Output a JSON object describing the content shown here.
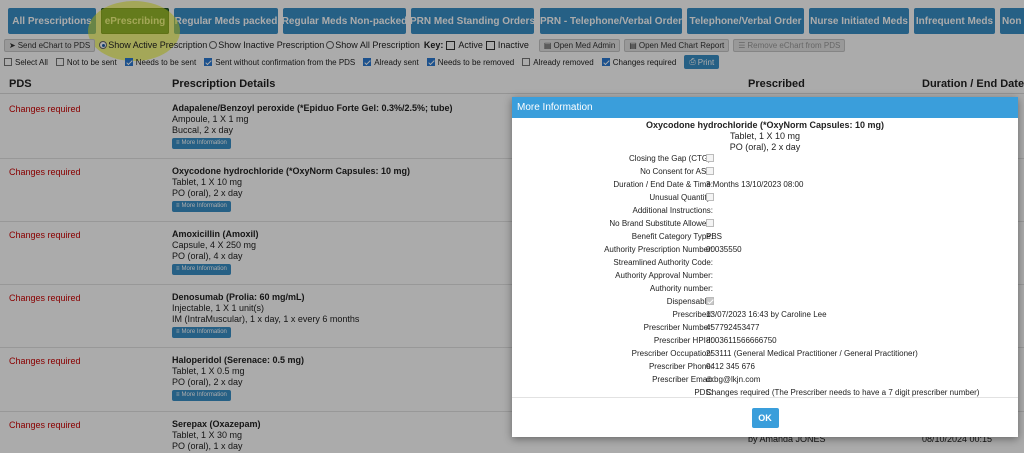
{
  "tabs": [
    {
      "label": "All Prescriptions"
    },
    {
      "label": "ePrescribing"
    },
    {
      "label": "Regular Meds packed"
    },
    {
      "label": "Regular Meds Non-packed"
    },
    {
      "label": "PRN Med Standing Orders"
    },
    {
      "label": "PRN - Telephone/Verbal Order"
    },
    {
      "label": "Telephone/Verbal Order"
    },
    {
      "label": "Nurse Initiated Meds"
    },
    {
      "label": "Infrequent Meds"
    },
    {
      "label": "Non"
    }
  ],
  "toolbar": {
    "send_label": "Send eChart to PDS",
    "radio_active": "Show Active Prescription",
    "radio_inactive": "Show Inactive Prescription",
    "radio_all": "Show All Prescription",
    "key_label": "Key:",
    "key_active": "Active",
    "key_inactive": "Inactive",
    "open_admin": "Open Med Admin",
    "open_report": "Open Med Chart Report",
    "remove_label": "Remove eChart from PDS"
  },
  "filters": [
    {
      "label": "Select All",
      "checked": false
    },
    {
      "label": "Not to be sent",
      "checked": false
    },
    {
      "label": "Needs to be sent",
      "checked": true
    },
    {
      "label": "Sent without confirmation from the PDS",
      "checked": true
    },
    {
      "label": "Already sent",
      "checked": true
    },
    {
      "label": "Needs to be removed",
      "checked": true
    },
    {
      "label": "Already removed",
      "checked": false
    },
    {
      "label": "Changes required",
      "checked": true
    }
  ],
  "print_label": "Print",
  "columns": {
    "pds": "PDS",
    "details": "Prescription Details",
    "prescribed": "Prescribed",
    "end": "Duration / End Date &"
  },
  "rows": [
    {
      "status": "Changes required",
      "name": "Adapalene/Benzoyl peroxide (*Epiduo Forte Gel: 0.3%/2.5%; tube)",
      "line1": "Ampoule, 1 X 1 mg",
      "line2": "Buccal, 2 x day",
      "more": "More Information",
      "prescribed": "",
      "end": ""
    },
    {
      "status": "Changes required",
      "name": "Oxycodone hydrochloride (*OxyNorm Capsules: 10 mg)",
      "line1": "Tablet, 1 X 10 mg",
      "line2": "PO (oral), 2 x day",
      "more": "More Information",
      "prescribed": "",
      "end": ""
    },
    {
      "status": "Changes required",
      "name": "Amoxicillin (Amoxil)",
      "line1": "Capsule, 4 X 250 mg",
      "line2": "PO (oral), 4 x day",
      "more": "More Information",
      "prescribed": "",
      "end": ""
    },
    {
      "status": "Changes required",
      "name": "Denosumab (Prolia: 60 mg/mL)",
      "line1": "Injectable, 1 X 1 unit(s)",
      "line2": "IM (IntraMuscular), 1 x day, 1 x every 6 months",
      "more": "More Information",
      "prescribed": "",
      "end": ""
    },
    {
      "status": "Changes required",
      "name": "Haloperidol (Serenace: 0.5 mg)",
      "line1": "Tablet, 1 X 0.5 mg",
      "line2": "PO (oral), 2 x day",
      "more": "More Information",
      "prescribed": "",
      "end": ""
    },
    {
      "status": "Changes required",
      "name": "Serepax (Oxazepam)",
      "line1": "Tablet, 1 X 30 mg",
      "line2": "PO (oral), 1 x day",
      "more": "",
      "prescribed": "by Amanda JONES",
      "end": "08/10/2024 00:15"
    }
  ],
  "modal": {
    "title": "More Information",
    "drug_name": "Oxycodone hydrochloride (*OxyNorm Capsules: 10 mg)",
    "drug_line1": "Tablet, 1 X 10 mg",
    "drug_line2": "PO (oral), 2 x day",
    "fields": [
      {
        "label": "Closing the Gap (CTG):",
        "type": "check",
        "checked": false,
        "value": ""
      },
      {
        "label": "No Consent for ASL:",
        "type": "check",
        "checked": false,
        "value": ""
      },
      {
        "label": "Duration / End Date & Time:",
        "type": "text",
        "checked": false,
        "value": "3 Months 13/10/2023 08:00"
      },
      {
        "label": "Unusual Quantity:",
        "type": "check",
        "checked": false,
        "value": ""
      },
      {
        "label": "Additional Instructions:",
        "type": "text",
        "checked": false,
        "value": ""
      },
      {
        "label": "No Brand Substitute Allowed:",
        "type": "check",
        "checked": false,
        "value": ""
      },
      {
        "label": "Benefit Category Type:",
        "type": "text",
        "checked": false,
        "value": "PBS"
      },
      {
        "label": "Authority Prescription Number:",
        "type": "text",
        "checked": false,
        "value": "00035550"
      },
      {
        "label": "Streamlined Authority Code:",
        "type": "text",
        "checked": false,
        "value": ""
      },
      {
        "label": "Authority Approval Number:",
        "type": "text",
        "checked": false,
        "value": ""
      },
      {
        "label": "Authority number:",
        "type": "text",
        "checked": false,
        "value": ""
      },
      {
        "label": "Dispensable:",
        "type": "check",
        "checked": true,
        "value": ""
      },
      {
        "label": "Prescribed:",
        "type": "text",
        "checked": false,
        "value": "13/07/2023 16:43 by Caroline Lee"
      },
      {
        "label": "Prescriber Number:",
        "type": "text",
        "checked": false,
        "value": "457792453477"
      },
      {
        "label": "Prescriber HPI-I:",
        "type": "text",
        "checked": false,
        "value": "8003611566666750"
      },
      {
        "label": "Prescriber Occupation:",
        "type": "text",
        "checked": false,
        "value": "253111 (General Medical Practitioner / General Practitioner)"
      },
      {
        "label": "Prescriber Phone:",
        "type": "text",
        "checked": false,
        "value": "0412 345 676"
      },
      {
        "label": "Prescriber Email:",
        "type": "text",
        "checked": false,
        "value": "cxbg@lkjn.com"
      },
      {
        "label": "PDS:",
        "type": "text",
        "checked": false,
        "value": "Changes required (The Prescriber needs to have a 7 digit prescriber number)"
      }
    ],
    "ok_label": "OK"
  }
}
